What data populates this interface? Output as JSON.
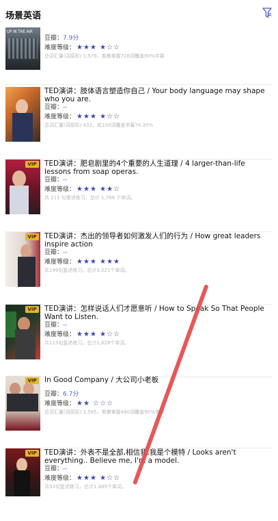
{
  "header": {
    "title": "场景英语",
    "filter_icon": "filter-icon"
  },
  "labels": {
    "douban": "豆瓣：",
    "difficulty": "难度等级："
  },
  "items": [
    {
      "title": "",
      "rating": "7.9分",
      "stars_on": "★★★",
      "stars_sep": "★",
      "stars_off": "☆☆",
      "meta": "总词汇量(词原形) 1,579，看着掌握726词覆盖90%字幕",
      "thumb_caption": "UP IN THE AIR",
      "thumb_colors": [
        "#5b6c78",
        "#2a2f33"
      ]
    },
    {
      "title": "TED演讲：肢体语言塑造你自己 / Your body language may shape who you are.",
      "rating": "--",
      "stars_on": "★★★",
      "stars_sep": "★",
      "stars_off": "☆☆",
      "meta": "总词汇量(词原形) 432，前100词覆盖字幕74.30%",
      "thumb_caption": "",
      "thumb_colors": [
        "#d88b3f",
        "#3a2b22"
      ]
    },
    {
      "title": "TED演讲：肥皂剧里的4个重要的人生道理 / 4 larger-than-life lessons from soap operas.",
      "rating": "--",
      "stars_on": "★★★",
      "stars_sep": "★★",
      "stars_off": "☆",
      "meta": "共 111 句重述练习，总计 1,788 个单词。",
      "thumb_caption": "",
      "thumb_colors": [
        "#9c1f3a",
        "#2d2030"
      ]
    },
    {
      "title": "TED演讲：杰出的领导者如何激发人们的行为 / How great leaders inspire action",
      "rating": "--",
      "stars_on": "★★★",
      "stars_sep": "★★★",
      "stars_off": "",
      "meta": "共199句复述练习，总计3,021个单词。",
      "thumb_caption": "",
      "thumb_colors": [
        "#e9e2dd",
        "#9a2f35"
      ]
    },
    {
      "title": "TED演讲：怎样说话人们才愿意听 / How to Speak So That People Want to Listen.",
      "rating": "--",
      "stars_on": "★★★",
      "stars_sep": "★",
      "stars_off": "☆☆",
      "meta": "共113句复述练习，总计1,828个单词。",
      "thumb_caption": "",
      "thumb_colors": [
        "#1e2a1e",
        "#c23a2d"
      ]
    },
    {
      "title": "In Good Company / 大公司小老板",
      "rating": "6.7分",
      "stars_on": "★★",
      "stars_sep": "",
      "stars_off": "☆☆☆",
      "meta": "总词汇量(词原形) 1,565，看着掌握480词覆盖90%字幕",
      "thumb_caption": "",
      "thumb_colors": [
        "#d9d1c6",
        "#8a1a25"
      ]
    },
    {
      "title": "TED演讲：外表不是全部,相信我,我是个模特 / Looks aren't everything.. Believe me, I'm a model.",
      "rating": "--",
      "stars_on": "★★★",
      "stars_sep": "★",
      "stars_off": "☆☆",
      "meta": "共92句复述练习，总计1,489个单词。",
      "thumb_caption": "",
      "thumb_colors": [
        "#7a1b1b",
        "#1c1c1c"
      ]
    }
  ],
  "vip": "VIP",
  "colors": {
    "accent": "#3847b2",
    "rating": "#4a66c8",
    "vip": "#e6b42c",
    "slash": "#e54f4f"
  }
}
